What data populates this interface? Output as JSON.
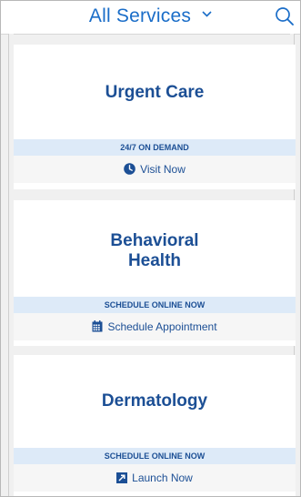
{
  "header": {
    "title": "All Services",
    "dropdown_icon": "chevron-down-icon",
    "search_icon": "search-icon"
  },
  "cards": [
    {
      "title_lines": [
        "Urgent Care"
      ],
      "banner": "24/7 ON DEMAND",
      "action_label": "Visit Now",
      "action_icon": "clock-icon"
    },
    {
      "title_lines": [
        "Behavioral",
        "Health"
      ],
      "banner": "SCHEDULE ONLINE NOW",
      "action_label": "Schedule Appointment",
      "action_icon": "calendar-icon"
    },
    {
      "title_lines": [
        "Dermatology"
      ],
      "banner": "SCHEDULE ONLINE NOW",
      "action_label": "Launch Now",
      "action_icon": "launch-icon"
    }
  ],
  "colors": {
    "accent": "#1a6dc8",
    "title_navy": "#1c4f95",
    "banner_bg": "#ddeaf8",
    "background": "#f0f0f0"
  }
}
